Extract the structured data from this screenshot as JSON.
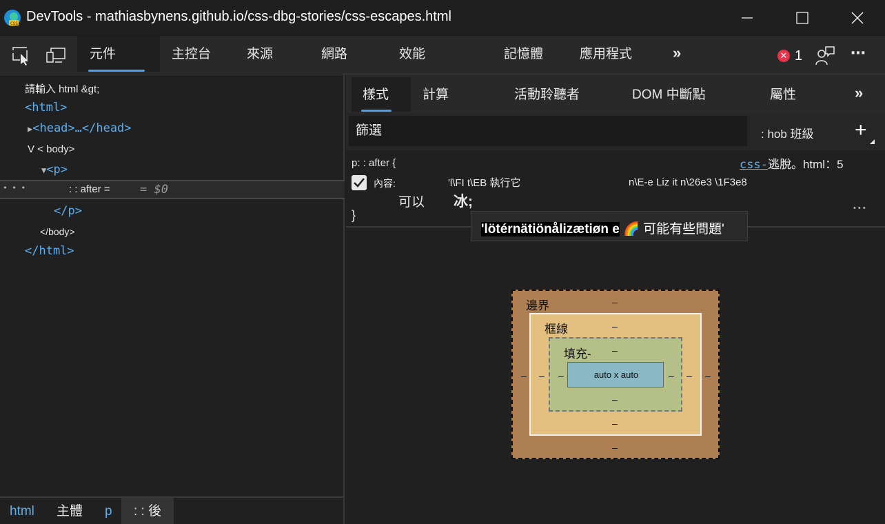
{
  "window": {
    "title": "DevTools - mathiasbynens.github.io/css-dbg-stories/css-escapes.html"
  },
  "toolbar": {
    "tabs": [
      "元件",
      "主控台",
      "來源",
      "網路",
      "效能",
      "記憶體",
      "應用程式"
    ],
    "more": "»",
    "error_count": "1",
    "error_badge": "✕",
    "overflow": "⋯"
  },
  "dom": {
    "placeholder_line": "請輸入 html &gt;",
    "html_open": "<html>",
    "head_line": "<head>…</head>",
    "body_open": "V < body>",
    "p_open": "<p>",
    "selected_pseudo": ": : after =",
    "selected_marker": "= $0",
    "row_dots": "• • •",
    "p_close": "</p>",
    "body_close": "</body>",
    "html_close": "</html>"
  },
  "breadcrumb": {
    "items": [
      "html",
      "主體",
      "p",
      ": : 後"
    ]
  },
  "styles": {
    "tabs": [
      "樣式",
      "計算",
      "活動聆聽者",
      "DOM 中斷點",
      "屬性"
    ],
    "more": "»",
    "filter_placeholder": "篩選",
    "hov_label": ": hob 班級",
    "add": "+",
    "rule": {
      "selector": "p: : after {",
      "source_link": "css-",
      "source_rest": "逃脫。html：5",
      "property": "內容:",
      "value_part1": "'l\\FI t\\EB 執行它",
      "value_part2": "n\\E-e Liz it n\\26e3 \\1F3e8",
      "line2_a": "可以",
      "line2_b": "冰;",
      "close": "}",
      "more": "• • •"
    },
    "tooltip": {
      "highlight": "'lötérnätiönålizætiøn e",
      "emoji": "🌈",
      "rest": "可能有些問題'"
    }
  },
  "box_model": {
    "margin_label": "邊界",
    "border_label": "框線",
    "padding_label": "填充-",
    "content": "auto x auto",
    "dash": "–"
  },
  "colors": {
    "accent": "#4ba0f0",
    "tag": "#5db0f0",
    "error": "#e8344b",
    "margin": "#ad7f52",
    "border": "#e3c07f",
    "padding": "#b5c088",
    "content": "#8ab8c4"
  }
}
